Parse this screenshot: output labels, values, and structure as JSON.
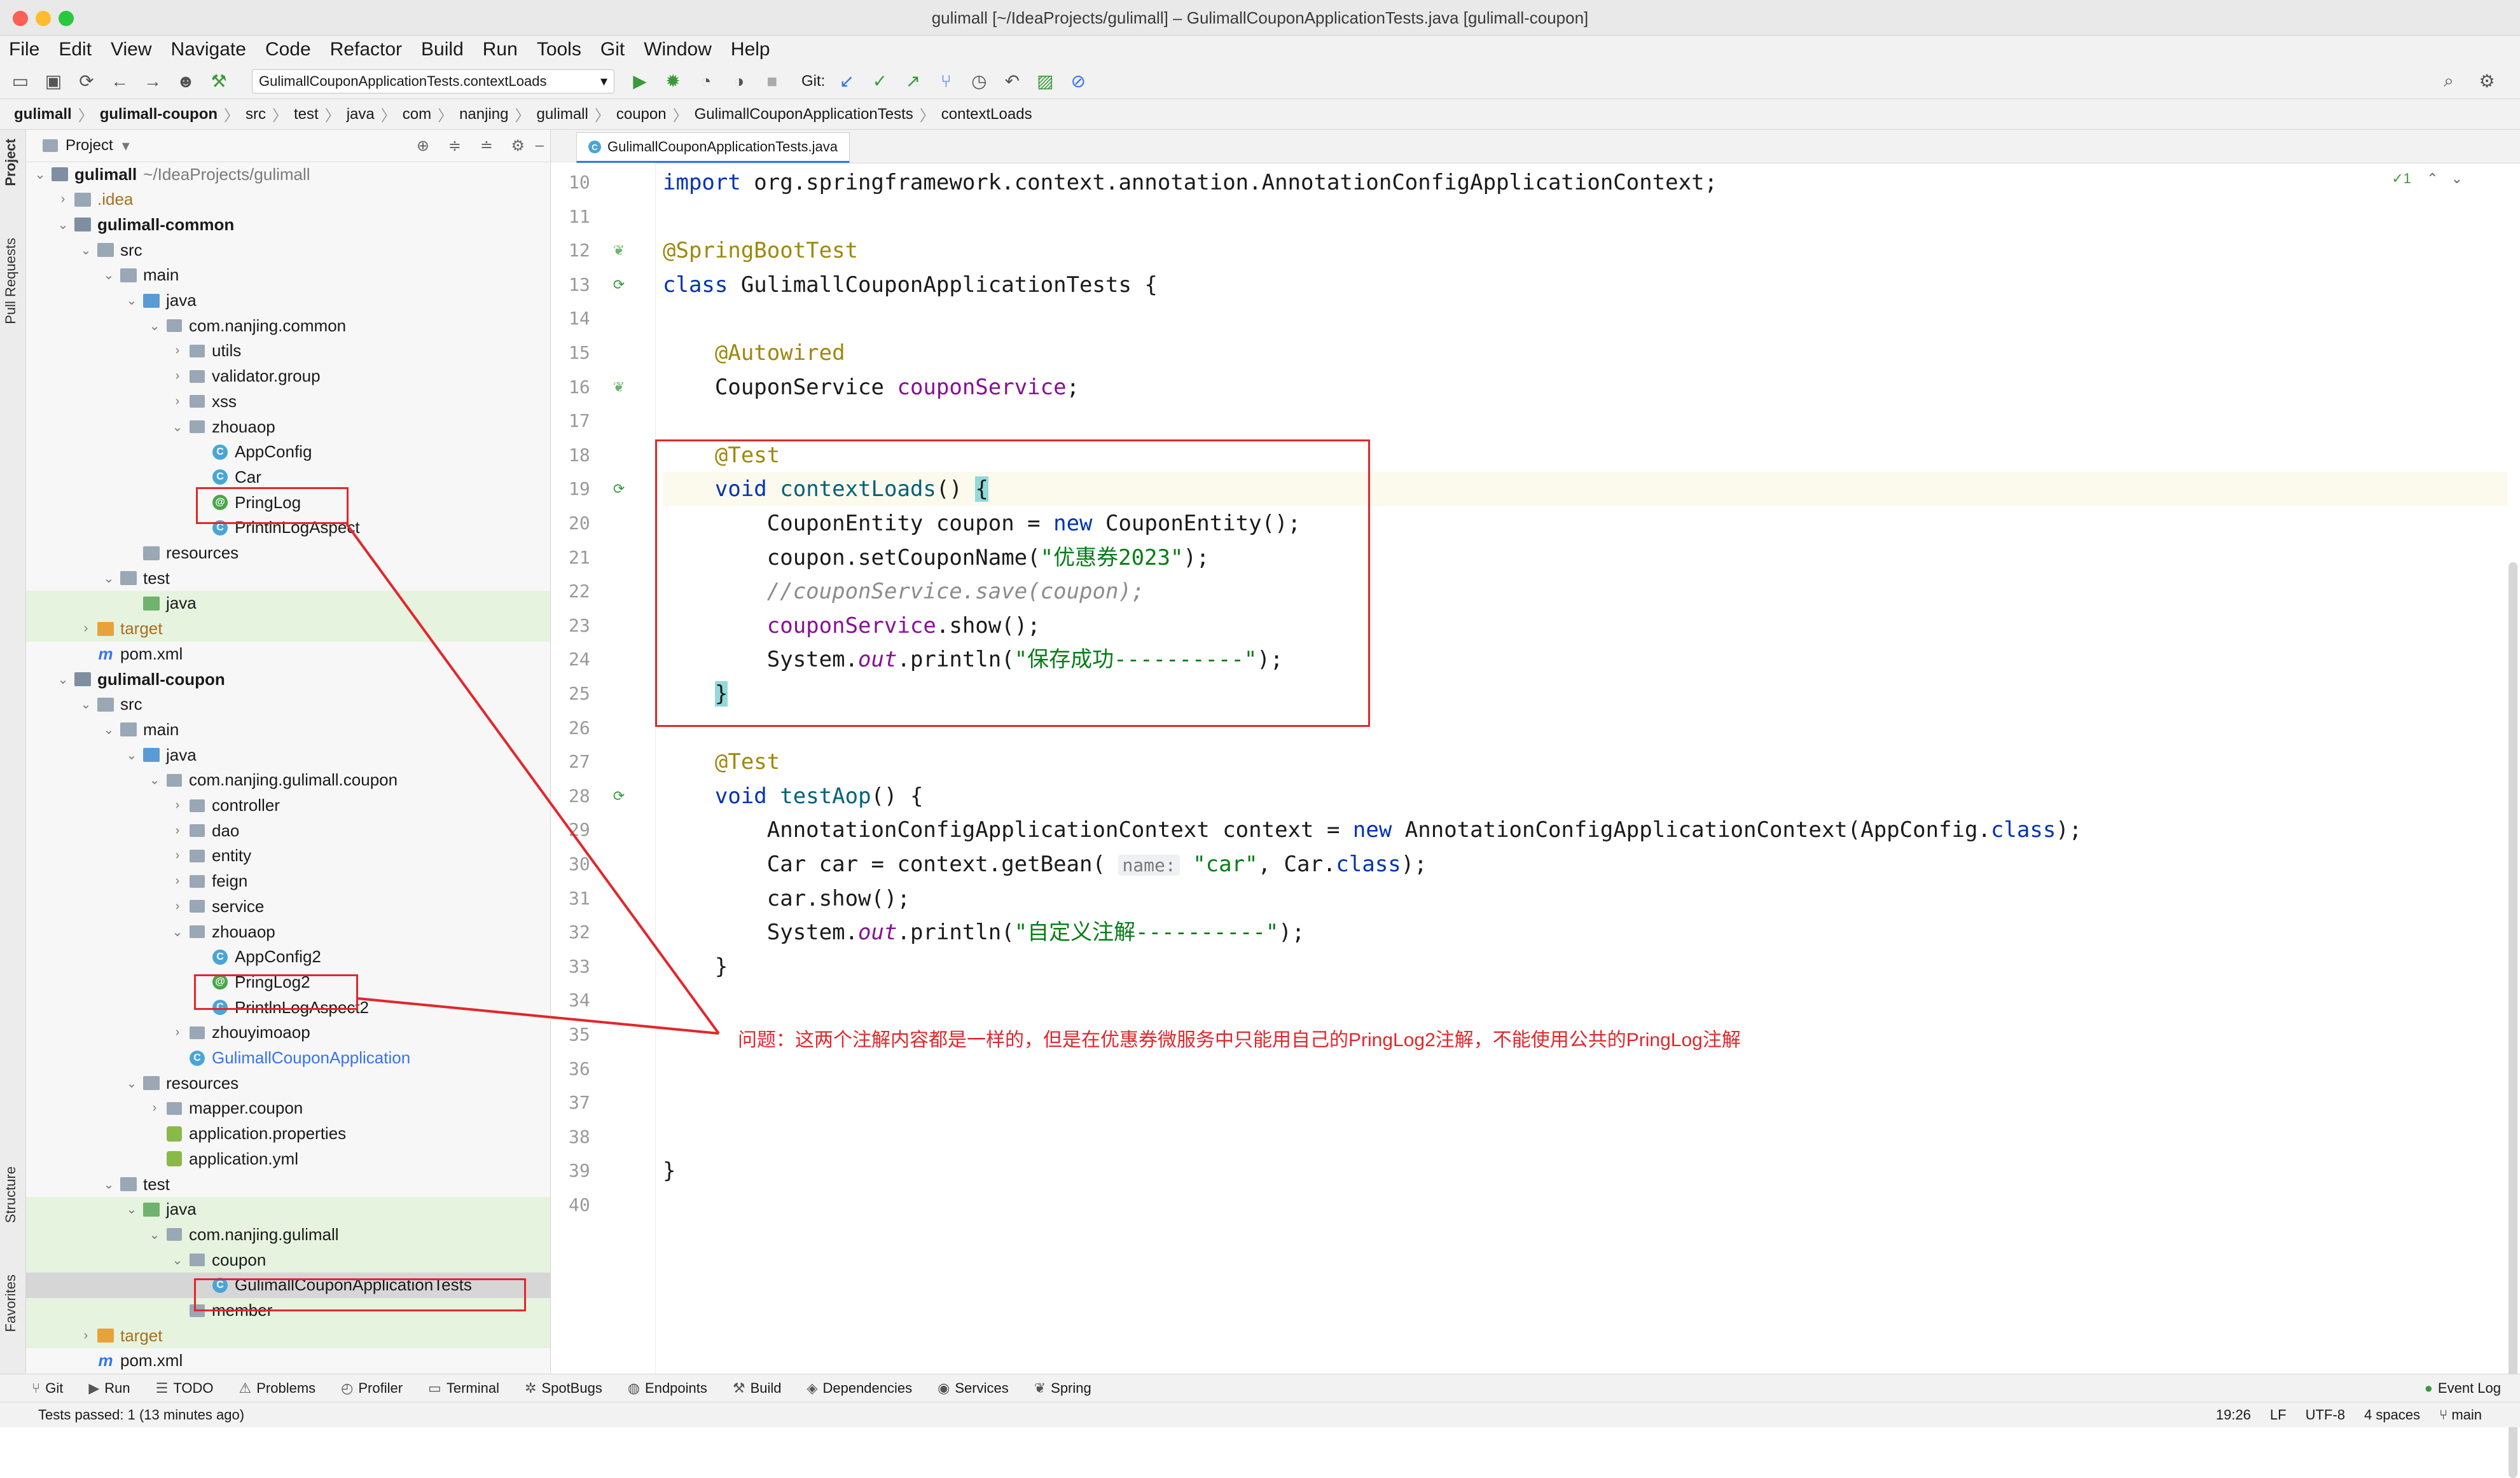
{
  "window": {
    "title": "gulimall [~/IdeaProjects/gulimall] – GulimallCouponApplicationTests.java [gulimall-coupon]"
  },
  "menu": [
    "File",
    "Edit",
    "View",
    "Navigate",
    "Code",
    "Refactor",
    "Build",
    "Run",
    "Tools",
    "Git",
    "Window",
    "Help"
  ],
  "toolbar": {
    "run_config": "GulimallCouponApplicationTests.contextLoads",
    "git_label": "Git:"
  },
  "breadcrumb": [
    "gulimall",
    "gulimall-coupon",
    "src",
    "test",
    "java",
    "com",
    "nanjing",
    "gulimall",
    "coupon",
    "GulimallCouponApplicationTests",
    "contextLoads"
  ],
  "left_tabs": {
    "project": "Project",
    "pull_requests": "Pull Requests",
    "structure": "Structure",
    "favorites": "Favorites"
  },
  "project_panel": {
    "title": "Project"
  },
  "tree": [
    {
      "label": "gulimall",
      "extra": "~/IdeaProjects/gulimall",
      "depth": 0,
      "arrow": "down",
      "icon": "module",
      "bold": true
    },
    {
      "label": ".idea",
      "depth": 1,
      "arrow": "right",
      "icon": "folder",
      "color": "orange"
    },
    {
      "label": "gulimall-common",
      "depth": 1,
      "arrow": "down",
      "icon": "module",
      "bold": true
    },
    {
      "label": "src",
      "depth": 2,
      "arrow": "down",
      "icon": "folder"
    },
    {
      "label": "main",
      "depth": 3,
      "arrow": "down",
      "icon": "folder"
    },
    {
      "label": "java",
      "depth": 4,
      "arrow": "down",
      "icon": "folder-blue"
    },
    {
      "label": "com.nanjing.common",
      "depth": 5,
      "arrow": "down",
      "icon": "package"
    },
    {
      "label": "utils",
      "depth": 6,
      "arrow": "right",
      "icon": "package"
    },
    {
      "label": "validator.group",
      "depth": 6,
      "arrow": "right",
      "icon": "package"
    },
    {
      "label": "xss",
      "depth": 6,
      "arrow": "right",
      "icon": "package"
    },
    {
      "label": "zhouaop",
      "depth": 6,
      "arrow": "down",
      "icon": "package"
    },
    {
      "label": "AppConfig",
      "depth": 7,
      "arrow": "",
      "icon": "class"
    },
    {
      "label": "Car",
      "depth": 7,
      "arrow": "",
      "icon": "class"
    },
    {
      "label": "PringLog",
      "depth": 7,
      "arrow": "",
      "icon": "annotation"
    },
    {
      "label": "PrintlnLogAspect",
      "depth": 7,
      "arrow": "",
      "icon": "class"
    },
    {
      "label": "resources",
      "depth": 4,
      "arrow": "",
      "icon": "folder-res"
    },
    {
      "label": "test",
      "depth": 3,
      "arrow": "down",
      "icon": "folder"
    },
    {
      "label": "java",
      "depth": 4,
      "arrow": "",
      "icon": "folder-green",
      "hl": true
    },
    {
      "label": "target",
      "depth": 2,
      "arrow": "right",
      "icon": "folder-orange",
      "color": "orange",
      "hl": true
    },
    {
      "label": "pom.xml",
      "depth": 2,
      "arrow": "",
      "icon": "maven"
    },
    {
      "label": "gulimall-coupon",
      "depth": 1,
      "arrow": "down",
      "icon": "module",
      "bold": true
    },
    {
      "label": "src",
      "depth": 2,
      "arrow": "down",
      "icon": "folder"
    },
    {
      "label": "main",
      "depth": 3,
      "arrow": "down",
      "icon": "folder"
    },
    {
      "label": "java",
      "depth": 4,
      "arrow": "down",
      "icon": "folder-blue"
    },
    {
      "label": "com.nanjing.gulimall.coupon",
      "depth": 5,
      "arrow": "down",
      "icon": "package"
    },
    {
      "label": "controller",
      "depth": 6,
      "arrow": "right",
      "icon": "package"
    },
    {
      "label": "dao",
      "depth": 6,
      "arrow": "right",
      "icon": "package"
    },
    {
      "label": "entity",
      "depth": 6,
      "arrow": "right",
      "icon": "package"
    },
    {
      "label": "feign",
      "depth": 6,
      "arrow": "right",
      "icon": "package"
    },
    {
      "label": "service",
      "depth": 6,
      "arrow": "right",
      "icon": "package"
    },
    {
      "label": "zhouaop",
      "depth": 6,
      "arrow": "down",
      "icon": "package"
    },
    {
      "label": "AppConfig2",
      "depth": 7,
      "arrow": "",
      "icon": "class"
    },
    {
      "label": "PringLog2",
      "depth": 7,
      "arrow": "",
      "icon": "annotation"
    },
    {
      "label": "PrintlnLogAspect2",
      "depth": 7,
      "arrow": "",
      "icon": "class"
    },
    {
      "label": "zhouyimoaop",
      "depth": 6,
      "arrow": "right",
      "icon": "package"
    },
    {
      "label": "GulimallCouponApplication",
      "depth": 6,
      "arrow": "",
      "icon": "class",
      "color": "blue"
    },
    {
      "label": "resources",
      "depth": 4,
      "arrow": "down",
      "icon": "folder-res"
    },
    {
      "label": "mapper.coupon",
      "depth": 5,
      "arrow": "right",
      "icon": "package"
    },
    {
      "label": "application.properties",
      "depth": 5,
      "arrow": "",
      "icon": "props"
    },
    {
      "label": "application.yml",
      "depth": 5,
      "arrow": "",
      "icon": "props"
    },
    {
      "label": "test",
      "depth": 3,
      "arrow": "down",
      "icon": "folder"
    },
    {
      "label": "java",
      "depth": 4,
      "arrow": "down",
      "icon": "folder-green",
      "hl": true
    },
    {
      "label": "com.nanjing.gulimall",
      "depth": 5,
      "arrow": "down",
      "icon": "package",
      "hl": true
    },
    {
      "label": "coupon",
      "depth": 6,
      "arrow": "down",
      "icon": "package",
      "hl": true
    },
    {
      "label": "GulimallCouponApplicationTests",
      "depth": 7,
      "arrow": "",
      "icon": "class",
      "sel": true
    },
    {
      "label": "member",
      "depth": 6,
      "arrow": "",
      "icon": "package",
      "hl": true
    },
    {
      "label": "target",
      "depth": 2,
      "arrow": "right",
      "icon": "folder-orange",
      "color": "orange",
      "hl": true
    },
    {
      "label": "pom.xml",
      "depth": 2,
      "arrow": "",
      "icon": "maven"
    }
  ],
  "editor": {
    "tab": "GulimallCouponApplicationTests.java",
    "inspection_count": "1",
    "lines": [
      {
        "n": "10",
        "tokens": [
          [
            "kw",
            "import "
          ],
          [
            "",
            "org.springframework.context.annotation.AnnotationConfigApplicationContext;"
          ]
        ]
      },
      {
        "n": "11",
        "tokens": []
      },
      {
        "n": "12",
        "tokens": [
          [
            "an",
            "@SpringBootTest"
          ]
        ]
      },
      {
        "n": "13",
        "tokens": [
          [
            "kw",
            "class "
          ],
          [
            "",
            "GulimallCouponApplicationTests {"
          ]
        ]
      },
      {
        "n": "14",
        "tokens": []
      },
      {
        "n": "15",
        "tokens": [
          [
            "",
            "    "
          ],
          [
            "an",
            "@Autowired"
          ]
        ]
      },
      {
        "n": "16",
        "tokens": [
          [
            "",
            "    CouponService "
          ],
          [
            "fld",
            "couponService"
          ],
          [
            "",
            ";"
          ]
        ]
      },
      {
        "n": "17",
        "tokens": []
      },
      {
        "n": "18",
        "tokens": [
          [
            "",
            "    "
          ],
          [
            "an",
            "@Test"
          ]
        ]
      },
      {
        "n": "19",
        "tokens": [
          [
            "",
            "    "
          ],
          [
            "kw",
            "void "
          ],
          [
            "fn",
            "contextLoads"
          ],
          [
            "",
            "() "
          ],
          [
            "brace",
            "{"
          ]
        ],
        "cur": true
      },
      {
        "n": "20",
        "tokens": [
          [
            "",
            "        CouponEntity coupon = "
          ],
          [
            "kw",
            "new "
          ],
          [
            "",
            "CouponEntity();"
          ]
        ]
      },
      {
        "n": "21",
        "tokens": [
          [
            "",
            "        coupon.setCouponName("
          ],
          [
            "str",
            "\"优惠券2023\""
          ],
          [
            "",
            ");"
          ]
        ]
      },
      {
        "n": "22",
        "tokens": [
          [
            "",
            "        "
          ],
          [
            "cm",
            "//couponService.save(coupon);"
          ]
        ]
      },
      {
        "n": "23",
        "tokens": [
          [
            "",
            "        "
          ],
          [
            "fld",
            "couponService"
          ],
          [
            "",
            ".show();"
          ]
        ]
      },
      {
        "n": "24",
        "tokens": [
          [
            "",
            "        System."
          ],
          [
            "fldi",
            "out"
          ],
          [
            "",
            ".println("
          ],
          [
            "str",
            "\"保存成功----------\""
          ],
          [
            "",
            ");"
          ]
        ]
      },
      {
        "n": "25",
        "tokens": [
          [
            "",
            "    "
          ],
          [
            "brace",
            "}"
          ]
        ]
      },
      {
        "n": "26",
        "tokens": []
      },
      {
        "n": "27",
        "tokens": [
          [
            "",
            "    "
          ],
          [
            "an",
            "@Test"
          ]
        ]
      },
      {
        "n": "28",
        "tokens": [
          [
            "",
            "    "
          ],
          [
            "kw",
            "void "
          ],
          [
            "fn",
            "testAop"
          ],
          [
            "",
            "() {"
          ]
        ]
      },
      {
        "n": "29",
        "tokens": [
          [
            "",
            "        AnnotationConfigApplicationContext context = "
          ],
          [
            "kw",
            "new "
          ],
          [
            "",
            "AnnotationConfigApplicationContext(AppConfig."
          ],
          [
            "kw",
            "class"
          ],
          [
            "",
            ");"
          ]
        ]
      },
      {
        "n": "30",
        "tokens": [
          [
            "",
            "        Car car = context.getBean( "
          ],
          [
            "hint",
            "name:"
          ],
          [
            "",
            ""
          ],
          [
            "str",
            " \"car\""
          ],
          [
            "",
            ", Car."
          ],
          [
            "kw",
            "class"
          ],
          [
            "",
            ");"
          ]
        ]
      },
      {
        "n": "31",
        "tokens": [
          [
            "",
            "        car.show();"
          ]
        ]
      },
      {
        "n": "32",
        "tokens": [
          [
            "",
            "        System."
          ],
          [
            "fldi",
            "out"
          ],
          [
            "",
            ".println("
          ],
          [
            "str",
            "\"自定义注解----------\""
          ],
          [
            "",
            ");"
          ]
        ]
      },
      {
        "n": "33",
        "tokens": [
          [
            "",
            "    }"
          ]
        ]
      },
      {
        "n": "34",
        "tokens": []
      },
      {
        "n": "35",
        "tokens": []
      },
      {
        "n": "36",
        "tokens": []
      },
      {
        "n": "37",
        "tokens": []
      },
      {
        "n": "38",
        "tokens": []
      },
      {
        "n": "39",
        "tokens": [
          [
            "",
            "}"
          ]
        ]
      },
      {
        "n": "40",
        "tokens": []
      }
    ]
  },
  "annotation_note": "问题：这两个注解内容都是一样的，但是在优惠券微服务中只能用自己的PringLog2注解，不能使用公共的PringLog注解",
  "tool_windows": [
    "Git",
    "Run",
    "TODO",
    "Problems",
    "Profiler",
    "Terminal",
    "SpotBugs",
    "Endpoints",
    "Build",
    "Dependencies",
    "Services",
    "Spring"
  ],
  "event_log": "Event Log",
  "status": {
    "message": "Tests passed: 1 (13 minutes ago)",
    "position": "19:26",
    "line_sep": "LF",
    "encoding": "UTF-8",
    "indent": "4 spaces",
    "branch": "main"
  },
  "colors": {
    "accent": "#3574f0",
    "annotation_red": "#e3262b"
  }
}
